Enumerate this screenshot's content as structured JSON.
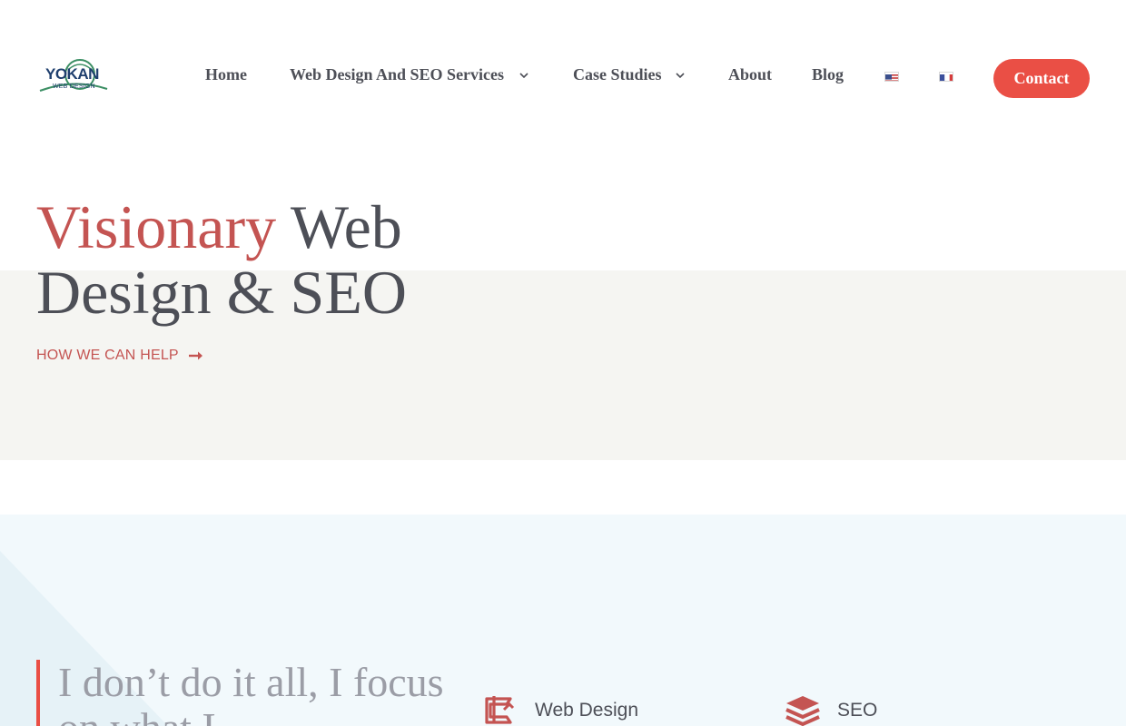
{
  "logo": {
    "name": "YOKAN",
    "subtitle": "WEB DESIGN"
  },
  "nav": {
    "items": [
      {
        "label": "Home",
        "has_dropdown": false
      },
      {
        "label": "Web Design And SEO Services",
        "has_dropdown": true
      },
      {
        "label": "Case Studies",
        "has_dropdown": true
      },
      {
        "label": "About",
        "has_dropdown": false
      },
      {
        "label": "Blog",
        "has_dropdown": false
      }
    ],
    "languages": [
      "flag-us-icon",
      "flag-fr-icon"
    ],
    "contact_label": "Contact"
  },
  "hero": {
    "title_accent": "Visionary",
    "title_rest_line1": " Web",
    "title_line2": "Design & SEO",
    "cta_label": "HOW WE CAN HELP",
    "cta_icon": "arrow-right-icon"
  },
  "section2": {
    "quote": "I don’t do it all, I focus on what I",
    "services": [
      {
        "icon": "crop-tool-icon",
        "label": "Web Design"
      },
      {
        "icon": "layers-stack-icon",
        "label": "SEO"
      }
    ]
  },
  "colors": {
    "accent": "#c45452",
    "button": "#ea4f45",
    "text": "#4d4f57",
    "band": "#f5f5f2",
    "section2_bg": "#f2f9fc"
  }
}
